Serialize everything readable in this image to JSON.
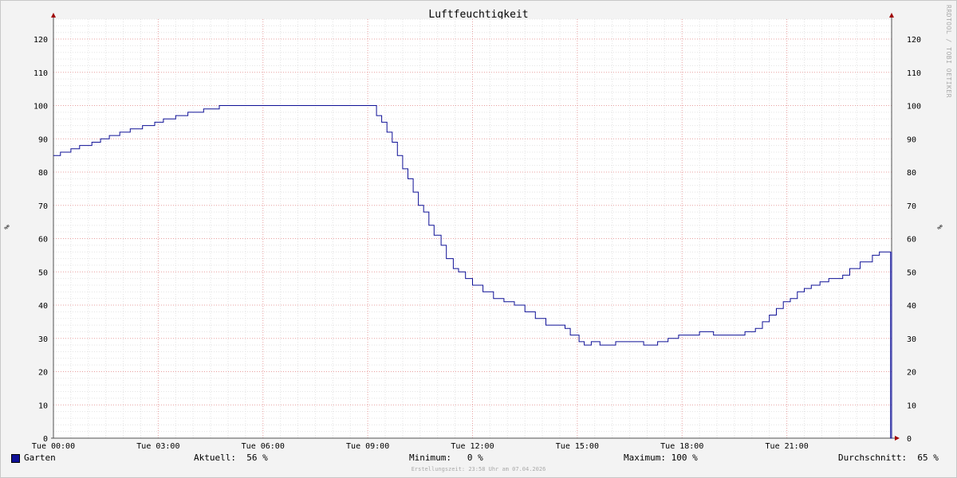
{
  "chart_data": {
    "type": "line",
    "title": "Luftfeuchtigkeit",
    "ylabel": "%",
    "ylim": [
      0,
      126
    ],
    "y_ticks": [
      0,
      10,
      20,
      30,
      40,
      50,
      60,
      70,
      80,
      90,
      100,
      110,
      120
    ],
    "x_range_hours": [
      0,
      24
    ],
    "x_ticks": [
      {
        "h": 0,
        "label": "Tue 00:00"
      },
      {
        "h": 3,
        "label": "Tue 03:00"
      },
      {
        "h": 6,
        "label": "Tue 06:00"
      },
      {
        "h": 9,
        "label": "Tue 09:00"
      },
      {
        "h": 12,
        "label": "Tue 12:00"
      },
      {
        "h": 15,
        "label": "Tue 15:00"
      },
      {
        "h": 18,
        "label": "Tue 18:00"
      },
      {
        "h": 21,
        "label": "Tue 21:00"
      }
    ],
    "grid": true,
    "series": [
      {
        "name": "Garten",
        "color": "#0f1096",
        "points": [
          [
            0.0,
            85
          ],
          [
            0.2,
            86
          ],
          [
            0.5,
            87
          ],
          [
            0.75,
            88
          ],
          [
            1.1,
            89
          ],
          [
            1.35,
            90
          ],
          [
            1.6,
            91
          ],
          [
            1.9,
            92
          ],
          [
            2.2,
            93
          ],
          [
            2.55,
            94
          ],
          [
            2.9,
            95
          ],
          [
            3.15,
            96
          ],
          [
            3.5,
            97
          ],
          [
            3.85,
            98
          ],
          [
            4.3,
            99
          ],
          [
            4.75,
            100
          ],
          [
            9.1,
            100
          ],
          [
            9.25,
            97
          ],
          [
            9.4,
            95
          ],
          [
            9.55,
            92
          ],
          [
            9.7,
            89
          ],
          [
            9.85,
            85
          ],
          [
            10.0,
            81
          ],
          [
            10.15,
            78
          ],
          [
            10.3,
            74
          ],
          [
            10.45,
            70
          ],
          [
            10.6,
            68
          ],
          [
            10.75,
            64
          ],
          [
            10.9,
            61
          ],
          [
            11.1,
            58
          ],
          [
            11.25,
            54
          ],
          [
            11.45,
            51
          ],
          [
            11.6,
            50
          ],
          [
            11.8,
            48
          ],
          [
            12.0,
            46
          ],
          [
            12.3,
            44
          ],
          [
            12.6,
            42
          ],
          [
            12.9,
            41
          ],
          [
            13.2,
            40
          ],
          [
            13.5,
            38
          ],
          [
            13.8,
            36
          ],
          [
            14.1,
            34
          ],
          [
            14.4,
            34
          ],
          [
            14.65,
            33
          ],
          [
            14.8,
            31
          ],
          [
            15.05,
            29
          ],
          [
            15.2,
            28
          ],
          [
            15.4,
            29
          ],
          [
            15.65,
            28
          ],
          [
            16.1,
            29
          ],
          [
            16.6,
            29
          ],
          [
            16.9,
            28
          ],
          [
            17.3,
            29
          ],
          [
            17.6,
            30
          ],
          [
            17.9,
            31
          ],
          [
            18.2,
            31
          ],
          [
            18.5,
            32
          ],
          [
            18.9,
            31
          ],
          [
            19.4,
            31
          ],
          [
            19.8,
            32
          ],
          [
            20.1,
            33
          ],
          [
            20.3,
            35
          ],
          [
            20.5,
            37
          ],
          [
            20.7,
            39
          ],
          [
            20.9,
            41
          ],
          [
            21.1,
            42
          ],
          [
            21.3,
            44
          ],
          [
            21.5,
            45
          ],
          [
            21.7,
            46
          ],
          [
            21.95,
            47
          ],
          [
            22.2,
            48
          ],
          [
            22.6,
            49
          ],
          [
            22.8,
            51
          ],
          [
            23.1,
            53
          ],
          [
            23.45,
            55
          ],
          [
            23.65,
            56
          ],
          [
            23.95,
            56
          ],
          [
            23.97,
            0
          ],
          [
            24.0,
            56
          ]
        ]
      }
    ]
  },
  "legend": {
    "series_name": "Garten",
    "current": "Aktuell:  56 %",
    "minimum": "Minimum:   0 %",
    "maximum": "Maximum: 100 %",
    "average": "Durchschnitt:  65 %"
  },
  "side_label": "RRDTOOL / TOBI OETIKER",
  "footer": "Erstellungszeit: 23:58 Uhr am 07.04.2026"
}
